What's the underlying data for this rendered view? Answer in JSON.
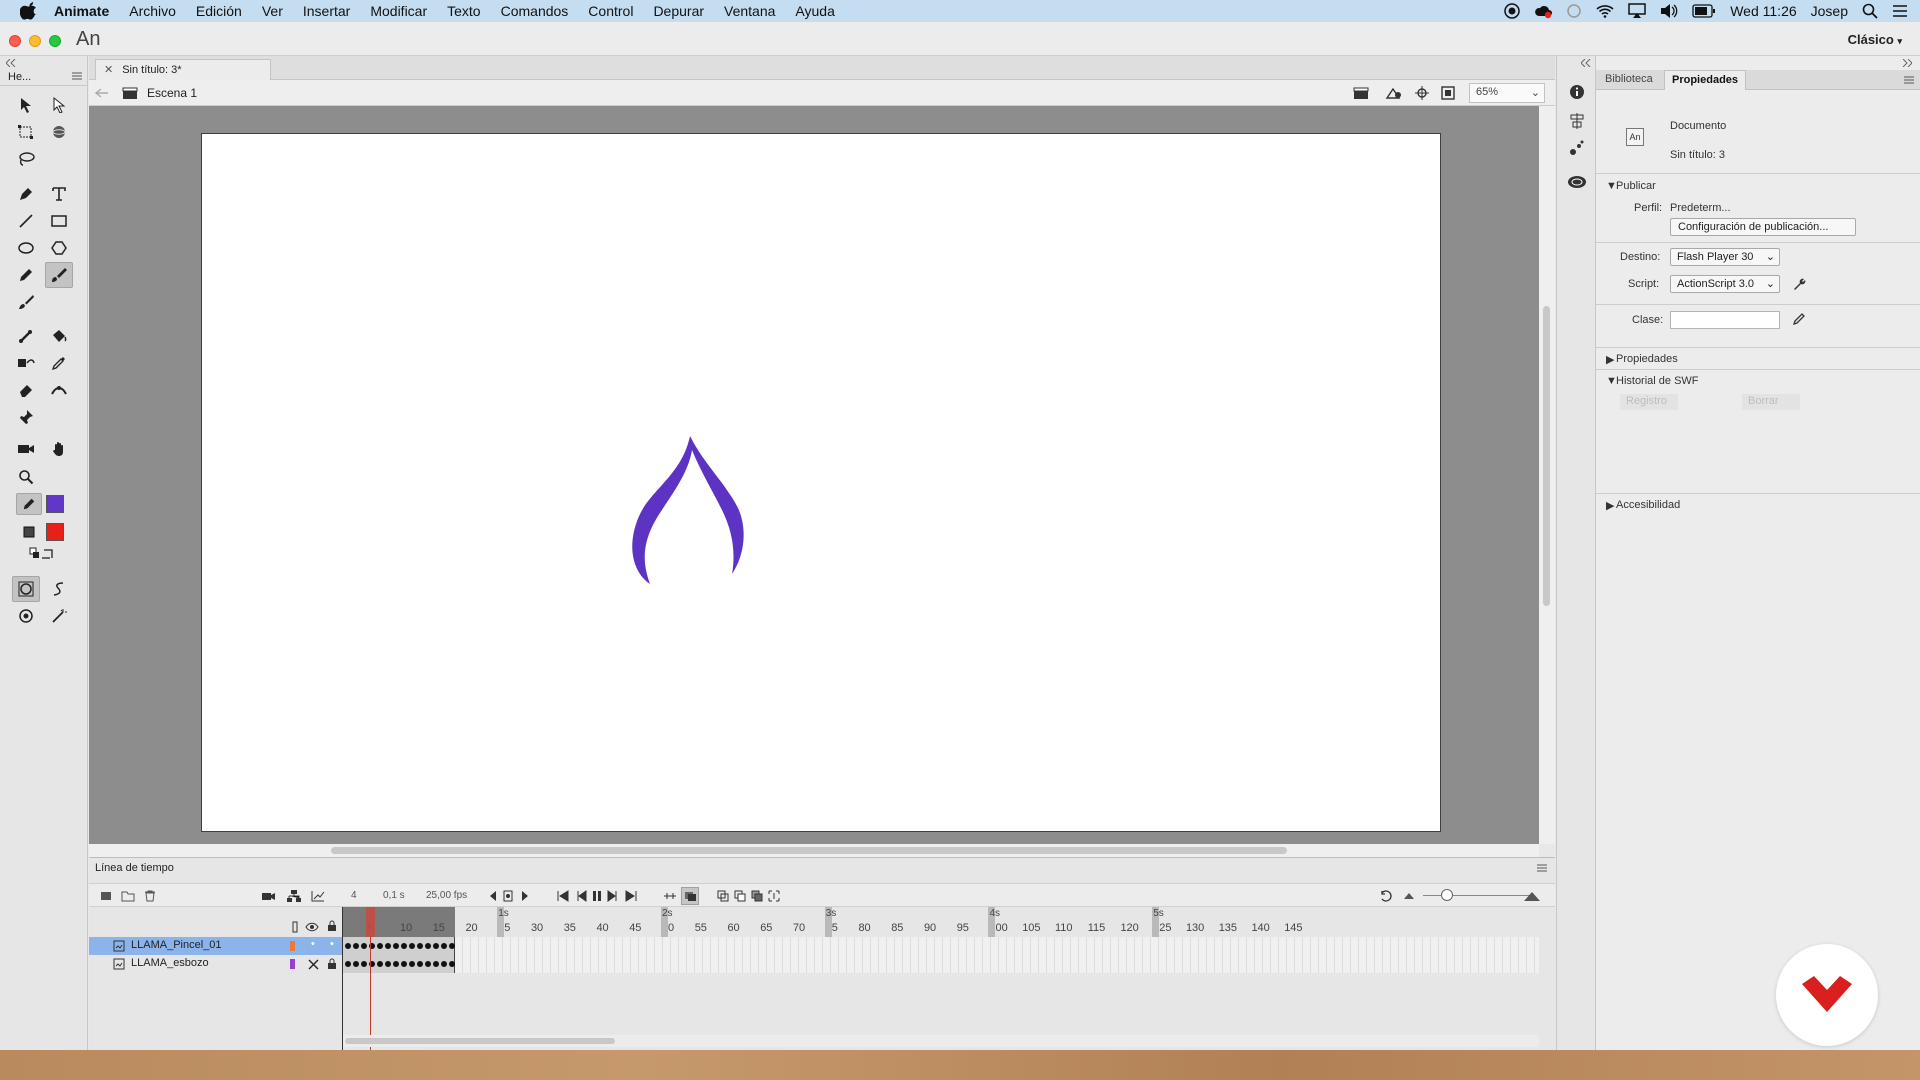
{
  "menubar": {
    "app_name": "Animate",
    "items": [
      "Archivo",
      "Edición",
      "Ver",
      "Insertar",
      "Modificar",
      "Texto",
      "Comandos",
      "Control",
      "Depurar",
      "Ventana",
      "Ayuda"
    ],
    "clock": "Wed 11:26",
    "user": "Josep"
  },
  "titlebar": {
    "app_logo": "An",
    "workspace": "Clásico"
  },
  "tools": {
    "panel_title": "He...",
    "stroke_color": "#6136c8",
    "fill_color": "#e8201a"
  },
  "document": {
    "tab_title": "Sin título: 3*",
    "scene": "Escena 1",
    "zoom": "65%",
    "stroke_color": "#5d33c4"
  },
  "timeline": {
    "title": "Línea de tiempo",
    "current_frame": "4",
    "elapsed": "0,1 s",
    "fps": "25,00 fps",
    "frame_numbers": [
      "5",
      "10",
      "15",
      "20",
      "25",
      "30",
      "35",
      "40",
      "45",
      "50",
      "55",
      "60",
      "65",
      "70",
      "75",
      "80",
      "85",
      "90",
      "95",
      "100",
      "105",
      "110",
      "115",
      "120",
      "125",
      "130",
      "135",
      "140",
      "145"
    ],
    "seconds": [
      "1s",
      "2s",
      "3s",
      "4s",
      "5s"
    ],
    "layers": [
      {
        "name": "LLAMA_Pincel_01",
        "color": "#e87a3c",
        "selected": true
      },
      {
        "name": "LLAMA_esbozo",
        "color": "#9b3fd0",
        "selected": false
      }
    ]
  },
  "properties": {
    "tabs": [
      "Biblioteca",
      "Propiedades"
    ],
    "active_tab": "Propiedades",
    "doc_type": "Documento",
    "doc_name": "Sin título: 3",
    "publish_section": "Publicar",
    "profile_label": "Perfil:",
    "profile_value": "Predeterm...",
    "publish_settings_button": "Configuración de publicación...",
    "target_label": "Destino:",
    "target_value": "Flash Player 30",
    "script_label": "Script:",
    "script_value": "ActionScript 3.0",
    "class_label": "Clase:",
    "properties_section": "Propiedades",
    "swf_history_section": "Historial de SWF",
    "log_button": "Registro",
    "clear_button": "Borrar",
    "accessibility_section": "Accesibilidad"
  }
}
